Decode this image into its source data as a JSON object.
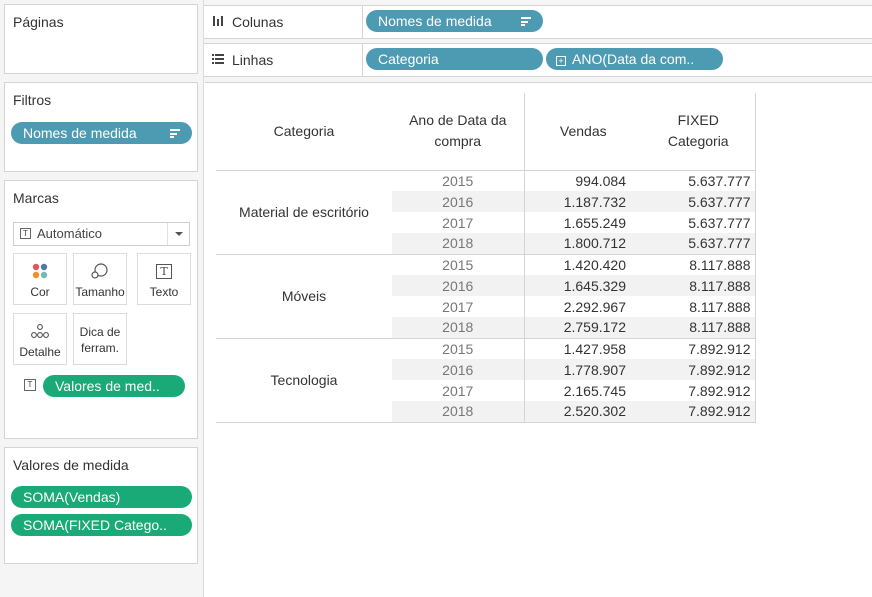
{
  "cards": {
    "pages": {
      "title": "Páginas"
    },
    "filters": {
      "title": "Filtros",
      "pill": "Nomes de medida"
    },
    "marks": {
      "title": "Marcas",
      "type_select": "Automático",
      "buttons": [
        "Cor",
        "Tamanho",
        "Texto",
        "Detalhe"
      ],
      "tooltip_btn_line1": "Dica de",
      "tooltip_btn_line2": "ferram.",
      "text_pill": "Valores de med.."
    },
    "measure_values": {
      "title": "Valores de medida",
      "pills": [
        "SOMA(Vendas)",
        "SOMA(FIXED Catego.."
      ]
    }
  },
  "shelves": {
    "columns": {
      "label": "Colunas",
      "pill": "Nomes de medida"
    },
    "rows": {
      "label": "Linhas",
      "pills": [
        "Categoria",
        "ANO(Data da com.."
      ]
    }
  },
  "table": {
    "headers": {
      "category": "Categoria",
      "year_line1": "Ano de Data da",
      "year_line2": "compra",
      "sales": "Vendas",
      "fixed_line1": "FIXED",
      "fixed_line2": "Categoria"
    },
    "groups": [
      {
        "category": "Material de escritório",
        "rows": [
          {
            "year": "2015",
            "sales": "994.084",
            "fixed": "5.637.777"
          },
          {
            "year": "2016",
            "sales": "1.187.732",
            "fixed": "5.637.777"
          },
          {
            "year": "2017",
            "sales": "1.655.249",
            "fixed": "5.637.777"
          },
          {
            "year": "2018",
            "sales": "1.800.712",
            "fixed": "5.637.777"
          }
        ]
      },
      {
        "category": "Móveis",
        "rows": [
          {
            "year": "2015",
            "sales": "1.420.420",
            "fixed": "8.117.888"
          },
          {
            "year": "2016",
            "sales": "1.645.329",
            "fixed": "8.117.888"
          },
          {
            "year": "2017",
            "sales": "2.292.967",
            "fixed": "8.117.888"
          },
          {
            "year": "2018",
            "sales": "2.759.172",
            "fixed": "8.117.888"
          }
        ]
      },
      {
        "category": "Tecnologia",
        "rows": [
          {
            "year": "2015",
            "sales": "1.427.958",
            "fixed": "7.892.912"
          },
          {
            "year": "2016",
            "sales": "1.778.907",
            "fixed": "7.892.912"
          },
          {
            "year": "2017",
            "sales": "2.165.745",
            "fixed": "7.892.912"
          },
          {
            "year": "2018",
            "sales": "2.520.302",
            "fixed": "7.892.912"
          }
        ]
      }
    ]
  },
  "colors": {
    "dimension_pill": "#4d9ab3",
    "measure_pill": "#1aaa78",
    "band": "#f2f2f2"
  },
  "icons": [
    "sort-descending-icon",
    "columns-icon",
    "rows-icon",
    "plus-box-icon",
    "text-icon",
    "color-dots-icon",
    "size-icon",
    "detail-icon",
    "dropdown-arrow-icon"
  ]
}
